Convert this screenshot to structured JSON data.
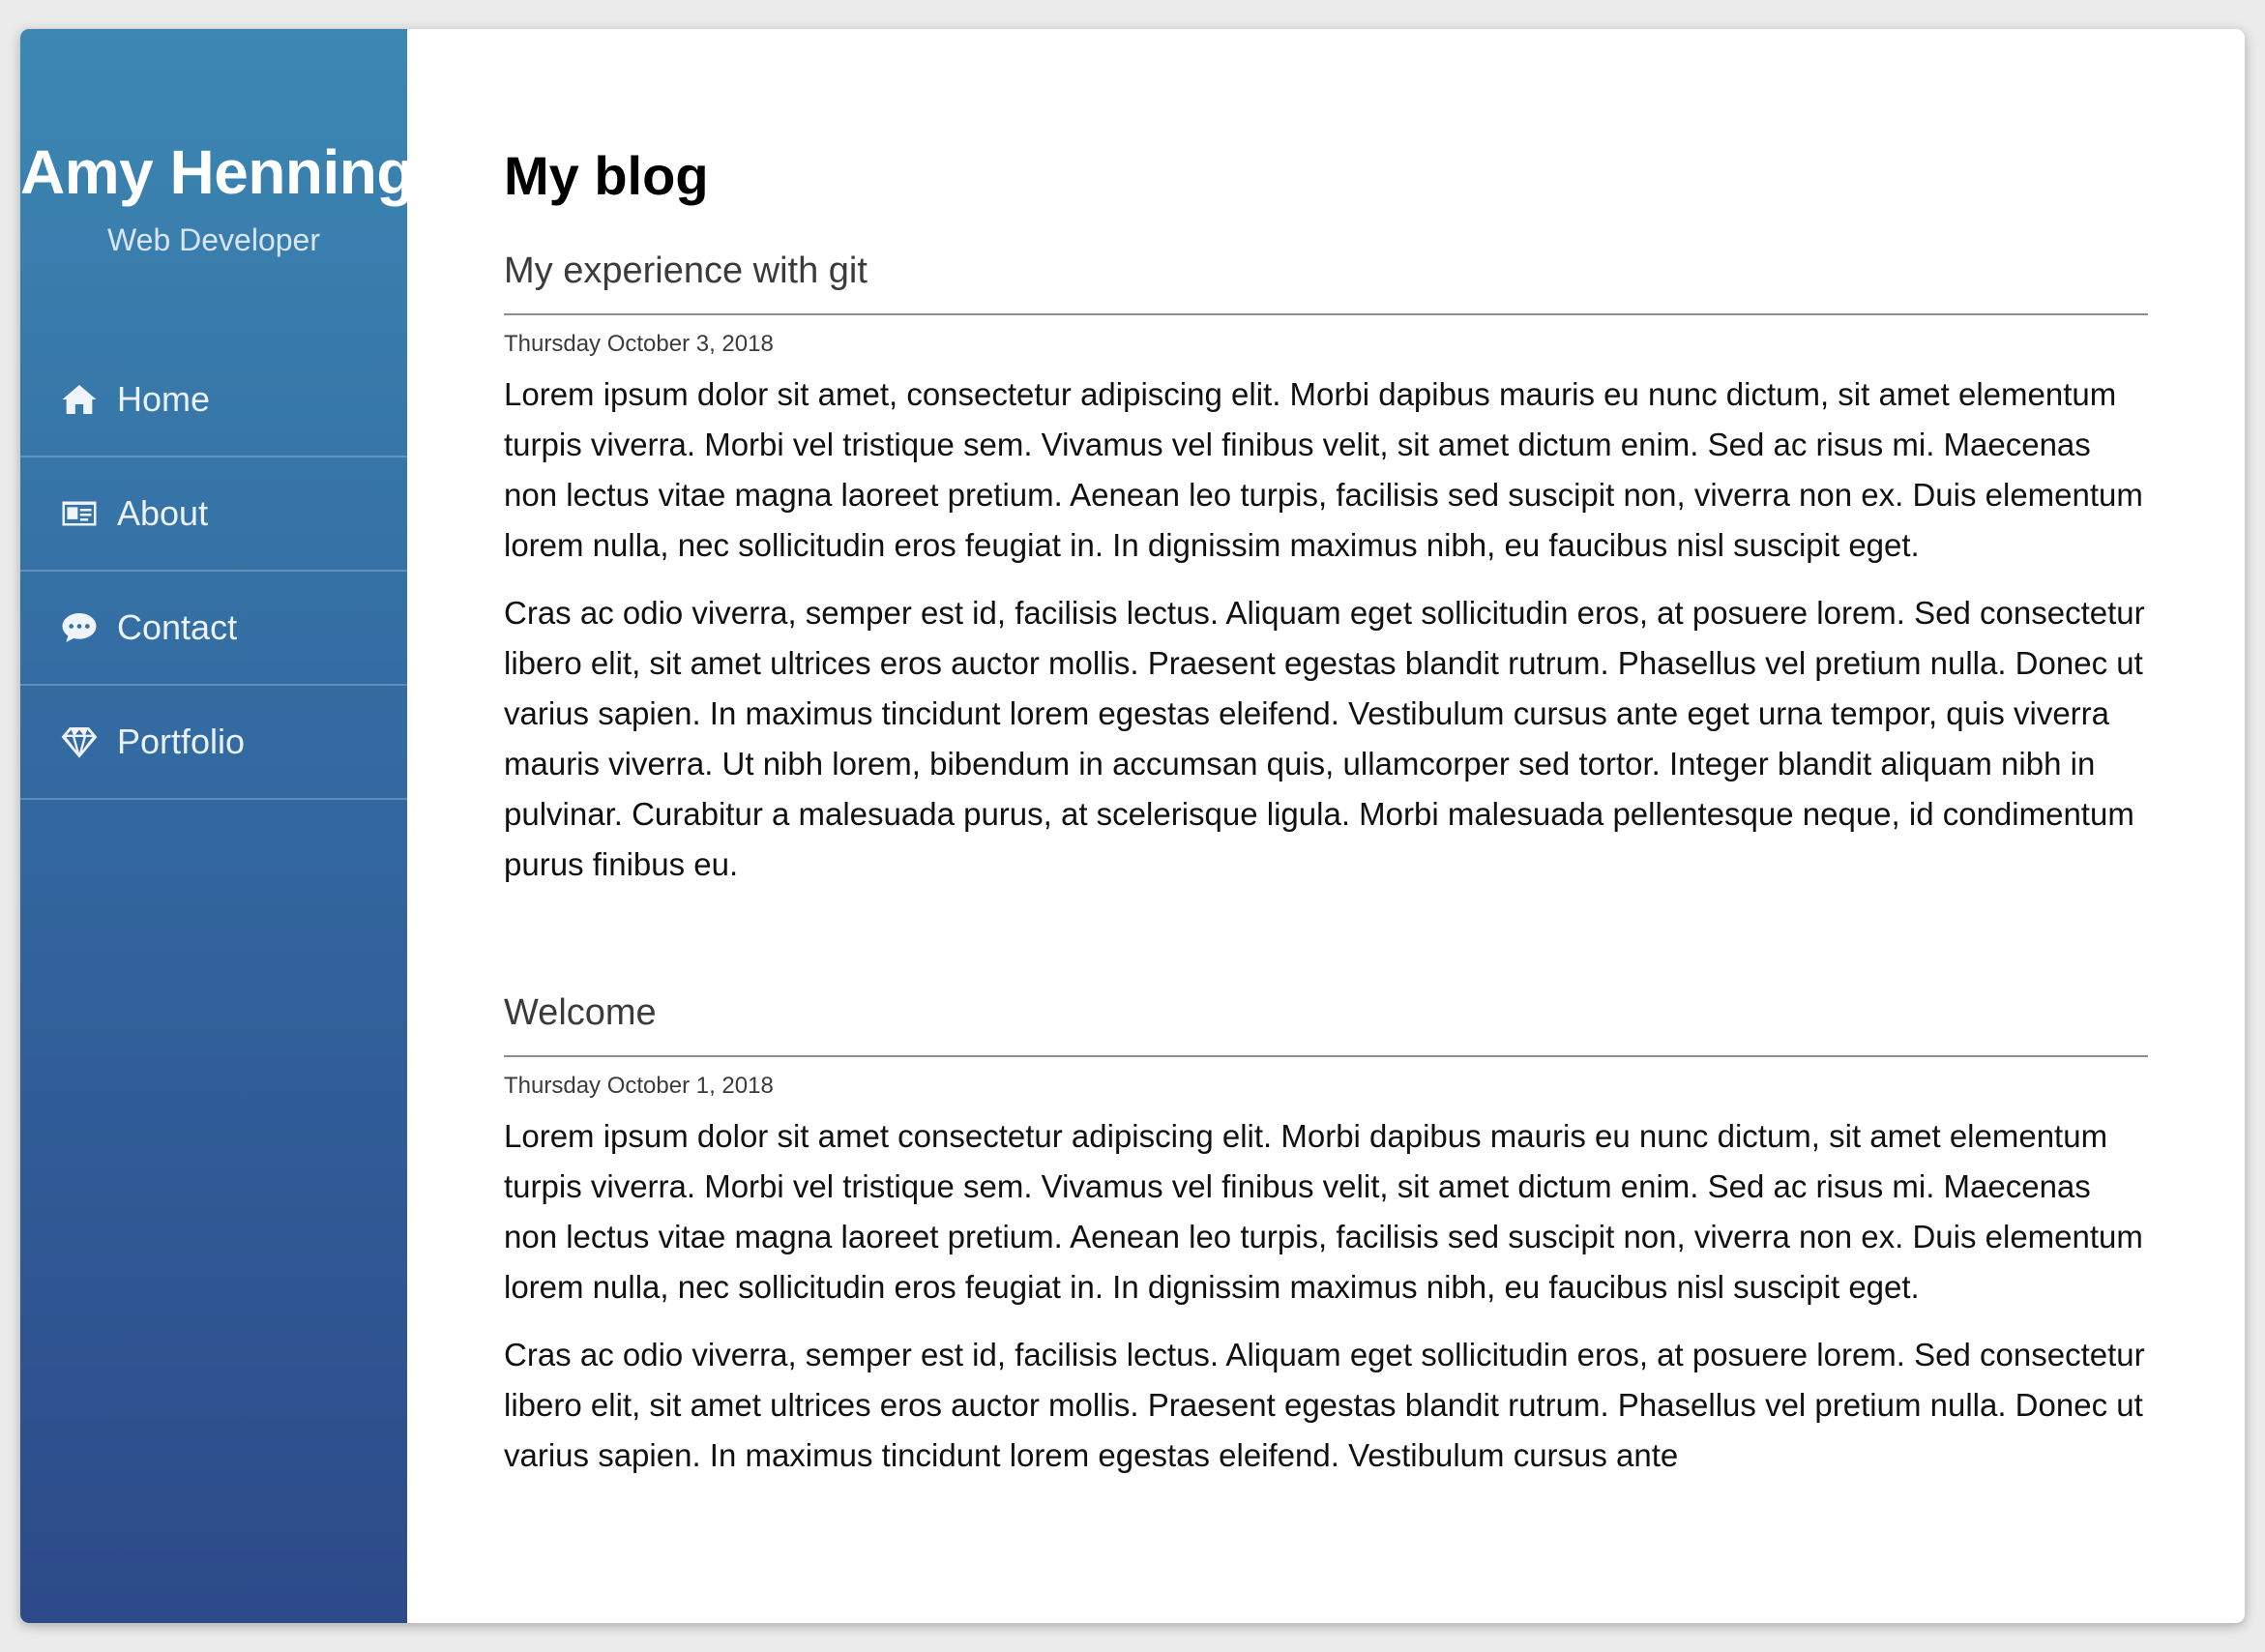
{
  "sidebar": {
    "name": "Amy Henning",
    "role": "Web Developer",
    "nav": [
      {
        "label": "Home",
        "icon": "home-icon"
      },
      {
        "label": "About",
        "icon": "id-card-icon"
      },
      {
        "label": "Contact",
        "icon": "chat-bubble-icon"
      },
      {
        "label": "Portfolio",
        "icon": "diamond-icon"
      }
    ]
  },
  "main": {
    "title": "My blog",
    "posts": [
      {
        "title": "My experience with git",
        "date": "Thursday October 3, 2018",
        "paragraphs": [
          "Lorem ipsum dolor sit amet, consectetur adipiscing elit. Morbi dapibus mauris eu nunc dictum, sit amet elementum turpis viverra. Morbi vel tristique sem. Vivamus vel finibus velit, sit amet dictum enim. Sed ac risus mi. Maecenas non lectus vitae magna laoreet pretium. Aenean leo turpis, facilisis sed suscipit non, viverra non ex. Duis elementum lorem nulla, nec sollicitudin eros feugiat in. In dignissim maximus nibh, eu faucibus nisl suscipit eget.",
          "Cras ac odio viverra, semper est id, facilisis lectus. Aliquam eget sollicitudin eros, at posuere lorem. Sed consectetur libero elit, sit amet ultrices eros auctor mollis. Praesent egestas blandit rutrum. Phasellus vel pretium nulla. Donec ut varius sapien. In maximus tincidunt lorem egestas eleifend. Vestibulum cursus ante eget urna tempor, quis viverra mauris viverra. Ut nibh lorem, bibendum in accumsan quis, ullamcorper sed tortor. Integer blandit aliquam nibh in pulvinar. Curabitur a malesuada purus, at scelerisque ligula. Morbi malesuada pellentesque neque, id condimentum purus finibus eu."
        ]
      },
      {
        "title": "Welcome",
        "date": "Thursday October 1, 2018",
        "paragraphs": [
          "Lorem ipsum dolor sit amet consectetur adipiscing elit. Morbi dapibus mauris eu nunc dictum, sit amet elementum turpis viverra. Morbi vel tristique sem. Vivamus vel finibus velit, sit amet dictum enim. Sed ac risus mi. Maecenas non lectus vitae magna laoreet pretium. Aenean leo turpis, facilisis sed suscipit non, viverra non ex. Duis elementum lorem nulla, nec sollicitudin eros feugiat in. In dignissim maximus nibh, eu faucibus nisl suscipit eget.",
          "Cras ac odio viverra, semper est id, facilisis lectus. Aliquam eget sollicitudin eros, at posuere lorem. Sed consectetur libero elit, sit amet ultrices eros auctor mollis. Praesent egestas blandit rutrum. Phasellus vel pretium nulla. Donec ut varius sapien. In maximus tincidunt lorem egestas eleifend. Vestibulum cursus ante"
        ]
      }
    ]
  }
}
